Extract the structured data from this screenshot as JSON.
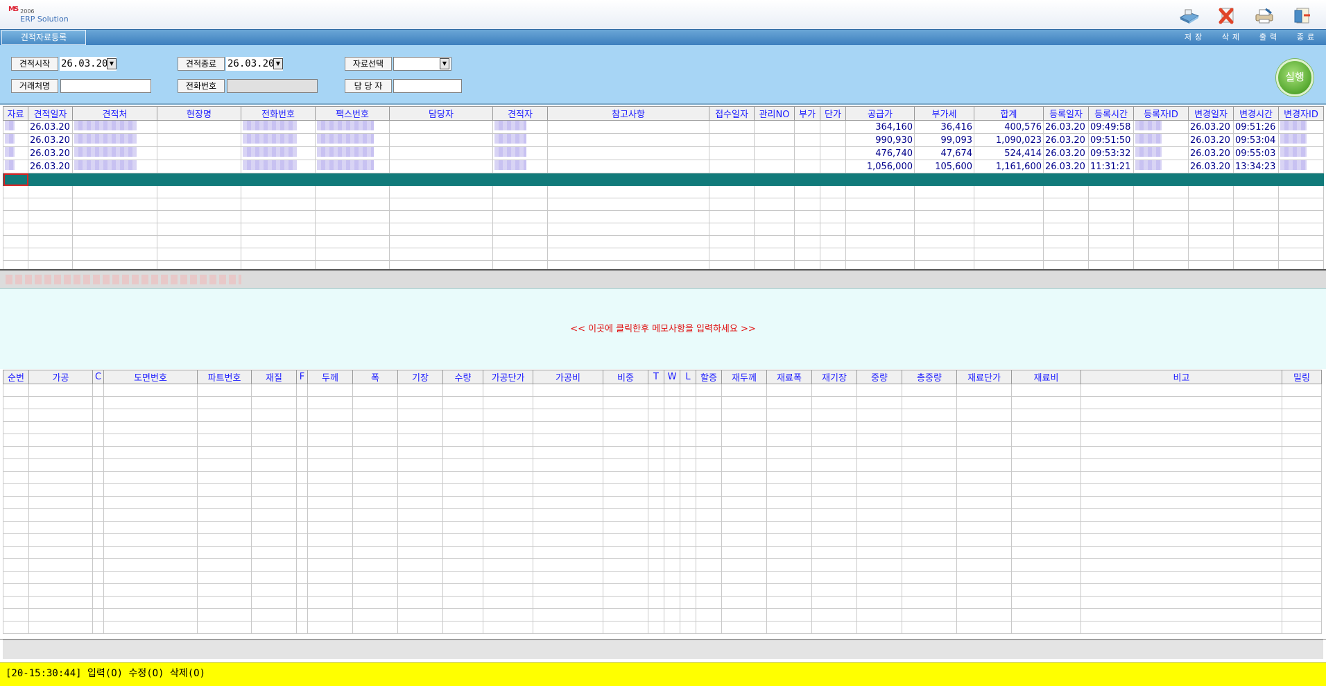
{
  "app": {
    "logo_text": "MS",
    "logo_year": "2006",
    "logo_sub": "ERP Solution",
    "menu_tab": "견적자료등록"
  },
  "toolbar": [
    {
      "label": "저장",
      "icon": "save-icon"
    },
    {
      "label": "삭제",
      "icon": "delete-icon"
    },
    {
      "label": "출력",
      "icon": "print-icon"
    },
    {
      "label": "종료",
      "icon": "exit-icon"
    }
  ],
  "filter": {
    "start_label": "견적시작",
    "start_value": "26.03.20",
    "end_label": "견적종료",
    "end_value": "26.03.20",
    "select_label": "자료선택",
    "select_value": "",
    "client_label": "거래처명",
    "client_value": "",
    "phone_label": "전화번호",
    "phone_value": "",
    "manager_label": "담 당 자",
    "manager_value": "",
    "run_label": "실행"
  },
  "quotes_grid": {
    "columns": [
      "자료",
      "견적일자",
      "견적처",
      "현장명",
      "전화번호",
      "팩스번호",
      "담당자",
      "견적자",
      "참고사항",
      "접수일자",
      "관리NO",
      "부가",
      "단가",
      "공급가",
      "부가세",
      "합계",
      "등록일자",
      "등록시간",
      "등록자ID",
      "변경일자",
      "변경시간",
      "변경자ID"
    ],
    "rows": [
      {
        "date": "26.03.20",
        "supply": "364,160",
        "vat": "36,416",
        "total": "400,576",
        "reg_date": "26.03.20",
        "reg_time": "09:49:58",
        "mod_date": "26.03.20",
        "mod_time": "09:51:26"
      },
      {
        "date": "26.03.20",
        "supply": "990,930",
        "vat": "99,093",
        "total": "1,090,023",
        "reg_date": "26.03.20",
        "reg_time": "09:51:50",
        "mod_date": "26.03.20",
        "mod_time": "09:53:04"
      },
      {
        "date": "26.03.20",
        "supply": "476,740",
        "vat": "47,674",
        "total": "524,414",
        "reg_date": "26.03.20",
        "reg_time": "09:53:32",
        "mod_date": "26.03.20",
        "mod_time": "09:55:03"
      },
      {
        "date": "26.03.20",
        "supply": "1,056,000",
        "vat": "105,600",
        "total": "1,161,600",
        "reg_date": "26.03.20",
        "reg_time": "11:31:21",
        "mod_date": "26.03.20",
        "mod_time": "13:34:23"
      }
    ]
  },
  "memo": {
    "placeholder": "<< 이곳에 클릭한후 메모사항을 입력하세요 >>"
  },
  "detail_grid": {
    "columns": [
      "순번",
      "가공",
      "C",
      "도면번호",
      "파트번호",
      "재질",
      "F",
      "두께",
      "폭",
      "기장",
      "수량",
      "가공단가",
      "가공비",
      "비중",
      "T",
      "W",
      "L",
      "할증",
      "재두께",
      "재료폭",
      "재기장",
      "중량",
      "총중량",
      "재료단가",
      "재료비",
      "비고",
      "밀링"
    ]
  },
  "status": {
    "text": "[20-15:30:44] 입력(O) 수정(O) 삭제(O)"
  },
  "colors": {
    "accent": "#a7d5f5",
    "header_text": "#1a1aff",
    "selected_row": "#117a7a",
    "memo_text": "#e01010",
    "status_bg": "#ffff00"
  }
}
